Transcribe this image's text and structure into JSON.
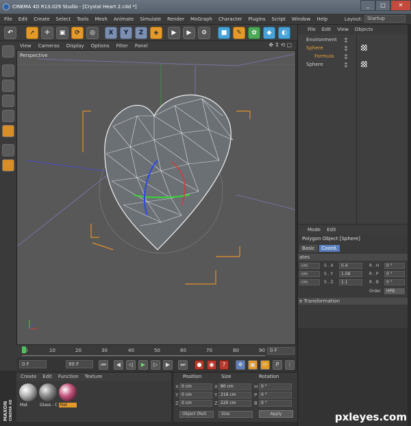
{
  "window": {
    "title": "CINEMA 4D R13.029 Studio - [Crystal Heart 2.c4d *]",
    "min": "_",
    "max": "□",
    "close": "✕"
  },
  "menu": [
    "File",
    "Edit",
    "Create",
    "Select",
    "Tools",
    "Mesh",
    "Animate",
    "Simulate",
    "Render",
    "MoGraph",
    "Character",
    "Plugins",
    "Script",
    "Window",
    "Help"
  ],
  "layout": {
    "label": "Layout:",
    "value": "Startup"
  },
  "toolbar": {
    "x": "X",
    "y": "Y",
    "z": "Z"
  },
  "viewport": {
    "menu": [
      "View",
      "Cameras",
      "Display",
      "Options",
      "Filter",
      "Panel"
    ],
    "label": "Perspective"
  },
  "timeline": {
    "ticks": [
      "0",
      "10",
      "20",
      "30",
      "40",
      "50",
      "60",
      "70",
      "80",
      "90"
    ],
    "frame": "0 F"
  },
  "transport": {
    "start": "0 F",
    "end": "90 F"
  },
  "materials": {
    "menu": [
      "Create",
      "Edit",
      "Function",
      "Texture"
    ],
    "items": [
      {
        "label": "Mat",
        "color": "#bdbdbd"
      },
      {
        "label": "Glass - C",
        "color": "#8a8a8a"
      },
      {
        "label": "Mat",
        "color": "#c6567f"
      }
    ]
  },
  "coords": {
    "headers": [
      "Position",
      "Size",
      "Rotation"
    ],
    "rows": [
      {
        "axis": "X",
        "pos": "0 cm",
        "size": "80 cm",
        "rlabel": "H",
        "rot": "0 °"
      },
      {
        "axis": "Y",
        "pos": "0 cm",
        "size": "216 cm",
        "rlabel": "P",
        "rot": "0 °"
      },
      {
        "axis": "Z",
        "pos": "0 cm",
        "size": "220 cm",
        "rlabel": "B",
        "rot": "0 °"
      }
    ],
    "mode": "Object (Rel)",
    "size_mode": "Size",
    "apply": "Apply"
  },
  "brand": {
    "line1": "MAXON",
    "line2": "CINEMA 4D"
  },
  "object_manager": {
    "menu": [
      "File",
      "Edit",
      "View",
      "Objects"
    ],
    "items": [
      {
        "name": "Environment",
        "color": "#d0d0d0",
        "indent": 0
      },
      {
        "name": "Sphere",
        "color": "#e8a23a",
        "indent": 0
      },
      {
        "name": "Formula",
        "color": "#e8a23a",
        "indent": 1
      },
      {
        "name": "Sphere",
        "color": "#d0d0d0",
        "indent": 0
      }
    ]
  },
  "attributes": {
    "menu": [
      "Mode",
      "Edit"
    ],
    "object": "Polygon Object [Sphere]",
    "tabs": [
      "Basic",
      "Coord."
    ],
    "section1": "ates",
    "rows": [
      {
        "u": "cm",
        "s": "S . X",
        "sv": "0.4",
        "r": "R . H",
        "rv": "0 °"
      },
      {
        "u": "cm",
        "s": "S . Y",
        "sv": "1.08",
        "r": "R . P",
        "rv": "0 °"
      },
      {
        "u": "cm",
        "s": "S . Z",
        "sv": "1.1",
        "r": "R . B",
        "rv": "0 °"
      }
    ],
    "order_label": "Order",
    "order_value": "HPB",
    "section2": "e Transformation"
  },
  "watermark": "pxleyes.com"
}
